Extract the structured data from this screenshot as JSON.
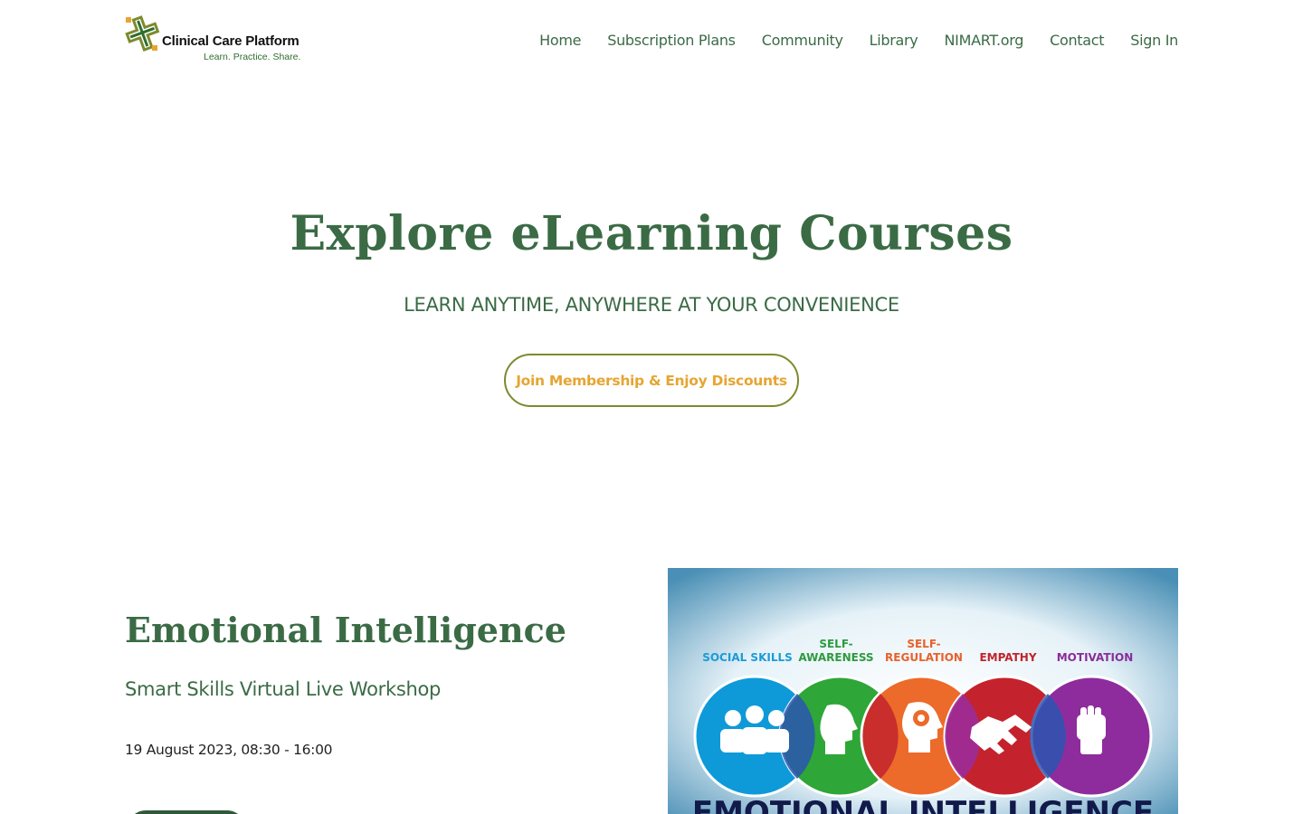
{
  "brand": {
    "name": "Clinical Care Platform",
    "tagline": "Learn. Practice. Share.",
    "colors": {
      "primary": "#3a6b45",
      "accent": "#e6a532",
      "border": "#7d8a2c"
    }
  },
  "nav": {
    "items": [
      "Home",
      "Subscription Plans",
      "Community",
      "Library",
      "NIMART.org",
      "Contact",
      "Sign In"
    ]
  },
  "hero": {
    "title": "Explore eLearning Courses",
    "subtitle": "LEARN ANYTIME, ANYWHERE AT YOUR CONVENIENCE",
    "cta_label": "Join Membership & Enjoy Discounts"
  },
  "course": {
    "title": "Emotional Intelligence",
    "subtitle": "Smart Skills Virtual Live Workshop",
    "date": "19 August 2023, 08:30 - 16:00",
    "image": {
      "labels": [
        {
          "text": "SOCIAL SKILLS",
          "color": "#1a9bd7"
        },
        {
          "text": "SELF-",
          "text2": "AWARENESS",
          "color": "#2e9a3e"
        },
        {
          "text": "SELF-",
          "text2": "REGULATION",
          "color": "#e8612a"
        },
        {
          "text": "EMPATHY",
          "color": "#c0242c"
        },
        {
          "text": "MOTIVATION",
          "color": "#8a2d9a"
        }
      ],
      "banner_text": "EMOTIONAL INTELLIGENCE"
    }
  }
}
